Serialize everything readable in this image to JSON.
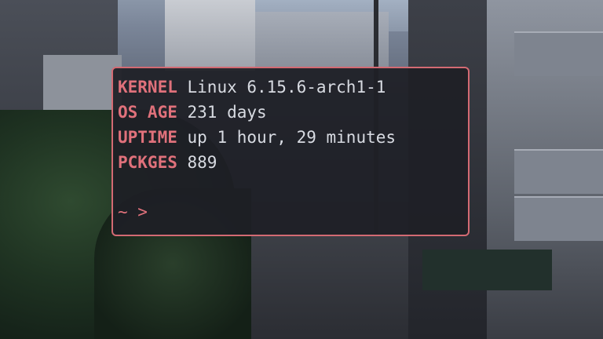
{
  "terminal": {
    "fetch": [
      {
        "key": "KERNEL",
        "value": "Linux 6.15.6-arch1-1"
      },
      {
        "key": "OS AGE",
        "value": "231 days"
      },
      {
        "key": "UPTIME",
        "value": "up 1 hour, 29 minutes"
      },
      {
        "key": "PCKGES",
        "value": "889"
      }
    ],
    "prompt": "~ >"
  },
  "colors": {
    "accent": "#e0717b",
    "border": "#d36a73",
    "text": "#d8dbe2",
    "background": "#1e1f26"
  }
}
